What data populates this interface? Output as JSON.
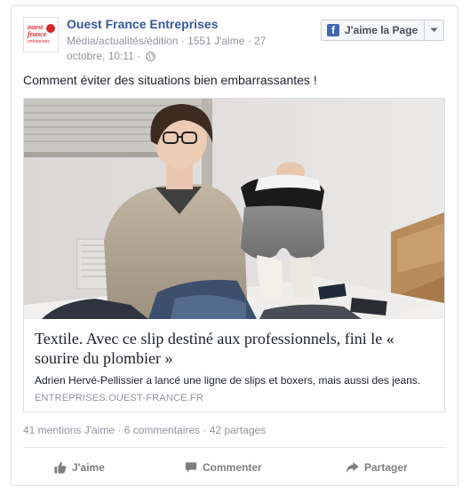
{
  "post": {
    "page_name": "Ouest France Entreprises",
    "avatar": {
      "line1": "ouest",
      "line2": "france",
      "line3": "entreprises",
      "color": "#d7262e"
    },
    "meta_text": "Média/actualités/édition · 1551 J'aime · 27 octobre, 10:11 ·",
    "like_page_label": "J'aime la Page",
    "message": "Comment éviter des situations bien embarrassantes !"
  },
  "link": {
    "title": "Textile. Avec ce slip destiné aux professionnels, fini le « sourire du plombier »",
    "description": "Adrien Hervé-Pellissier a lancé une ligne de slips et boxers, mais aussi des jeans.",
    "domain": "ENTREPRISES.OUEST-FRANCE.FR"
  },
  "stats": {
    "likes": "41 mentions J'aime",
    "comments": "6 commentaires",
    "shares": "42 partages",
    "separator": " · "
  },
  "actions": {
    "like": "J'aime",
    "comment": "Commenter",
    "share": "Partager"
  },
  "colors": {
    "facebook_blue": "#4267b2",
    "link_blue": "#365899",
    "meta_grey": "#90949c"
  }
}
